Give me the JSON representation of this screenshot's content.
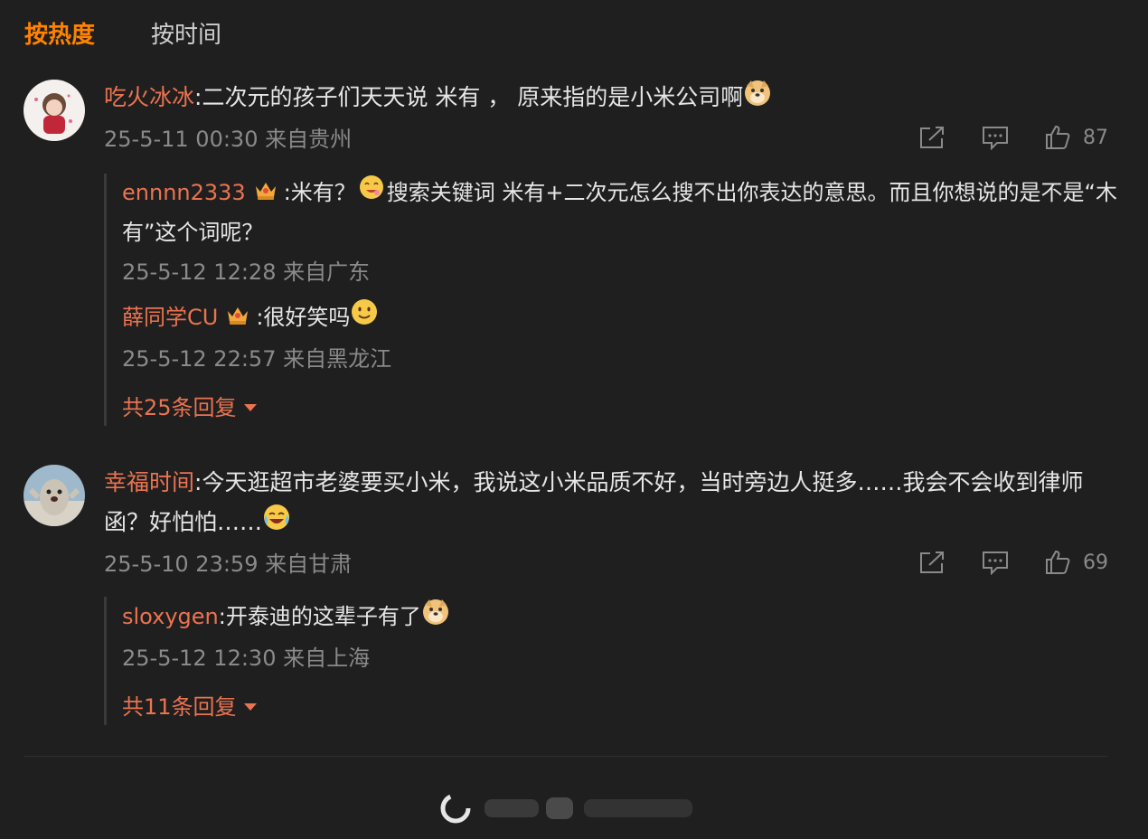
{
  "tabs": {
    "hot": "按热度",
    "time": "按时间"
  },
  "colors": {
    "accent": "#ff8200",
    "username": "#eb7350",
    "background": "#1f1f1f",
    "meta": "#8a8a8a"
  },
  "comments": [
    {
      "user": "吃火冰冰",
      "text": ":二次元的孩子们天天说 米有 ， 原来指的是小米公司啊",
      "emoji": "doge-emoji",
      "time": "25-5-11 00:30 来自贵州",
      "likes": "87",
      "replies": [
        {
          "user": "ennnn2333",
          "badge": "crown-badge",
          "text_a": ":米有？",
          "emoji": "yummy-emoji",
          "text_b": "搜索关键词 米有+二次元怎么搜不出你表达的意思。而且你想说的是不是“木有”这个词呢？",
          "time": "25-5-12 12:28 来自广东"
        },
        {
          "user": "薛同学CU",
          "badge": "crown-badge",
          "text_a": ":很好笑吗",
          "emoji": "smile-emoji",
          "text_b": "",
          "time": "25-5-12 22:57 来自黑龙江"
        }
      ],
      "more": "共25条回复"
    },
    {
      "user": "幸福时间",
      "text": ":今天逛超市老婆要买小米，我说这小米品质不好，当时旁边人挺多……我会不会收到律师函？好怕怕……",
      "emoji": "laugh-cry-emoji",
      "time": "25-5-10 23:59 来自甘肃",
      "likes": "69",
      "replies": [
        {
          "user": "sloxygen",
          "badge": "",
          "text_a": ":开泰迪的这辈子有了",
          "emoji": "doge-emoji",
          "text_b": "",
          "time": "25-5-12 12:30 来自上海"
        }
      ],
      "more": "共11条回复"
    }
  ]
}
